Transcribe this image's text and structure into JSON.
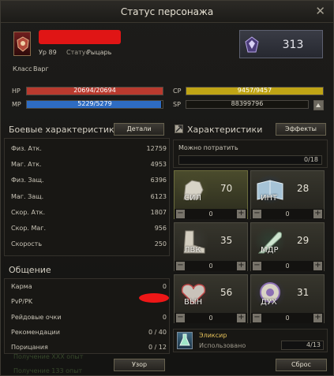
{
  "window": {
    "title": "Статус персонажа",
    "close_glyph": "✕"
  },
  "character": {
    "level": "Ур 89",
    "status_label": "Статус",
    "status_value": "Рыцарь",
    "class_label": "Класс",
    "class_value": "Варг",
    "rank_value": "313"
  },
  "bars": {
    "hp": {
      "label": "HP",
      "text": "20694/20694",
      "fraction": 1.0,
      "color": "#b93a2e"
    },
    "mp": {
      "label": "MP",
      "text": "5229/5279",
      "fraction": 0.99,
      "color": "#2e6cc2"
    },
    "cp": {
      "label": "CP",
      "text": "9457/9457",
      "fraction": 1.0,
      "color": "#bfa415"
    },
    "sp": {
      "label": "SP",
      "text": "88399796"
    }
  },
  "combat": {
    "title": "Боевые характеристики",
    "details_button": "Детали",
    "rows": [
      {
        "k": "Физ. Атк.",
        "v": "12759"
      },
      {
        "k": "Маг. Атк.",
        "v": "4953"
      },
      {
        "k": "Физ. Защ.",
        "v": "6396"
      },
      {
        "k": "Маг. Защ.",
        "v": "6123"
      },
      {
        "k": "Скор. Атк.",
        "v": "1807"
      },
      {
        "k": "Скор. Маг.",
        "v": "956"
      },
      {
        "k": "Скорость",
        "v": "250"
      }
    ]
  },
  "social": {
    "title": "Общение",
    "rows": [
      {
        "k": "Карма",
        "v": "0"
      },
      {
        "k": "PvP/PK",
        "v": ""
      },
      {
        "k": "Рейдовые очки",
        "v": "0"
      },
      {
        "k": "Рекомендации",
        "v": "0 / 40"
      },
      {
        "k": "Порицания",
        "v": "0 / 12"
      }
    ],
    "pattern_button": "Узор"
  },
  "attributes": {
    "title": "Характеристики",
    "effects_button": "Эффекты",
    "spend_label": "Можно потратить",
    "spend_value": "0/18",
    "tiles": [
      {
        "abbr": "СИЛ",
        "value": "70",
        "count": "0",
        "icon": "fist-icon"
      },
      {
        "abbr": "ИНТ",
        "value": "28",
        "count": "0",
        "icon": "book-icon"
      },
      {
        "abbr": "ЛВК",
        "value": "35",
        "count": "0",
        "icon": "boot-icon"
      },
      {
        "abbr": "МДР",
        "value": "29",
        "count": "0",
        "icon": "quill-icon"
      },
      {
        "abbr": "ВЫН",
        "value": "56",
        "count": "0",
        "icon": "heart-icon"
      },
      {
        "abbr": "ДУХ",
        "value": "31",
        "count": "0",
        "icon": "spirit-icon"
      }
    ],
    "minus_glyph": "−",
    "plus_glyph": "+",
    "elixir_title": "Эликсир",
    "elixir_label": "Использовано",
    "elixir_value": "4/13",
    "reset_button": "Сброс"
  },
  "background": {
    "chat_line_1": "Получение ХХХ опыт",
    "chat_line_2": "Получение 133 опыт"
  }
}
